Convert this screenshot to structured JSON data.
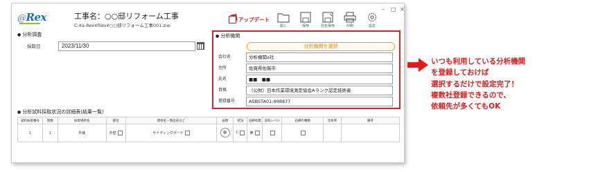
{
  "app": {
    "logo_text": "Rex",
    "logo_prefix": "@",
    "work_title": "工事名：○○邸リフォーム工事",
    "work_path": "C:¥a-Rex¥files¥○○邸リフォーム工事001.ziw"
  },
  "toolbar": {
    "update_label": "アップデート",
    "buttons": [
      {
        "label": "開く",
        "icon": "folder-icon"
      },
      {
        "label": "保存",
        "icon": "save-icon"
      },
      {
        "label": "別名保存",
        "icon": "save-as-icon"
      },
      {
        "label": "印刷",
        "icon": "print-icon"
      },
      {
        "label": "設定",
        "icon": "gear-icon"
      }
    ],
    "window_controls": [
      "–",
      "□",
      "×"
    ]
  },
  "sampling": {
    "section_label": "分析調査",
    "date_label": "採取日",
    "date_value": "2023/11/30"
  },
  "lab": {
    "section_label": "分析機関",
    "select_button": "分析機関を選択",
    "fields": [
      {
        "label": "会社名",
        "value": "分析機関a社"
      },
      {
        "label": "住所",
        "value": "佐賀県佐賀市"
      },
      {
        "label": "氏名",
        "value": "■■　■■"
      },
      {
        "label": "資格",
        "value": "（公財）日本作業環境測定協会Aランク認定技術者"
      },
      {
        "label": "登録番号",
        "value": "ASBSTA01-998877"
      }
    ]
  },
  "details": {
    "section_label": "分析試料採取状況の詳細表(結果一覧)",
    "headers": [
      "試料採取番号",
      "階数",
      "採取場所名",
      "部位",
      "建材名・製品名など",
      "画像",
      "状況",
      "石綿有無",
      "含有レベル",
      "石綿の種類",
      "含有率",
      "備考"
    ],
    "row": {
      "no": "1",
      "floor": "1",
      "place": "外装",
      "part": "外壁",
      "material": "サイディングボード",
      "status": "C",
      "asbestos": "無"
    }
  },
  "annotation": {
    "lines": [
      "いつも利用している分析機関",
      "を登録しておけば",
      "選択するだけで設定完了！",
      "複数社登録できるので、",
      "依頼先が多くてもOK"
    ],
    "color": "#e31b1b"
  },
  "colors": {
    "accent_red": "#e02020",
    "select_orange": "#e3a21a",
    "logo_blue": "#1b6fb5"
  }
}
